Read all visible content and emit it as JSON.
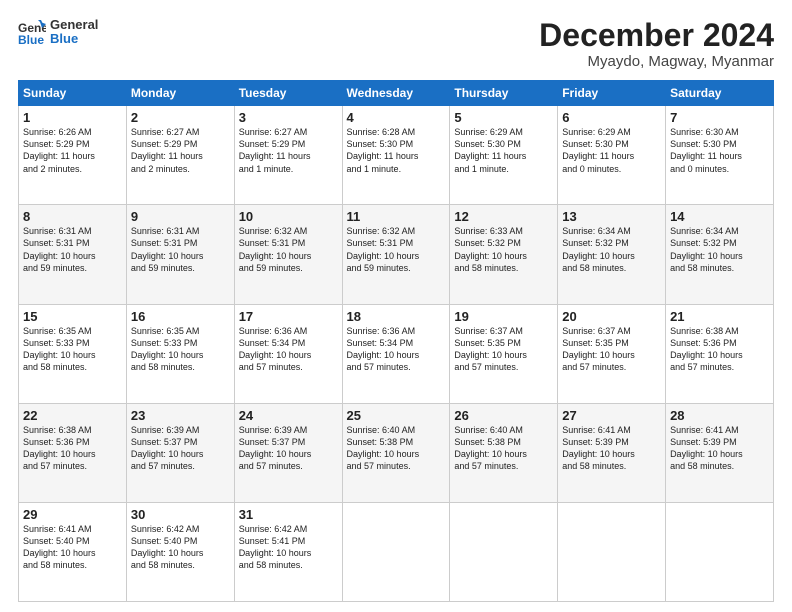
{
  "logo": {
    "line1": "General",
    "line2": "Blue"
  },
  "header": {
    "title": "December 2024",
    "subtitle": "Myaydo, Magway, Myanmar"
  },
  "columns": [
    "Sunday",
    "Monday",
    "Tuesday",
    "Wednesday",
    "Thursday",
    "Friday",
    "Saturday"
  ],
  "weeks": [
    [
      {
        "day": "1",
        "lines": [
          "Sunrise: 6:26 AM",
          "Sunset: 5:29 PM",
          "Daylight: 11 hours",
          "and 2 minutes."
        ]
      },
      {
        "day": "2",
        "lines": [
          "Sunrise: 6:27 AM",
          "Sunset: 5:29 PM",
          "Daylight: 11 hours",
          "and 2 minutes."
        ]
      },
      {
        "day": "3",
        "lines": [
          "Sunrise: 6:27 AM",
          "Sunset: 5:29 PM",
          "Daylight: 11 hours",
          "and 1 minute."
        ]
      },
      {
        "day": "4",
        "lines": [
          "Sunrise: 6:28 AM",
          "Sunset: 5:30 PM",
          "Daylight: 11 hours",
          "and 1 minute."
        ]
      },
      {
        "day": "5",
        "lines": [
          "Sunrise: 6:29 AM",
          "Sunset: 5:30 PM",
          "Daylight: 11 hours",
          "and 1 minute."
        ]
      },
      {
        "day": "6",
        "lines": [
          "Sunrise: 6:29 AM",
          "Sunset: 5:30 PM",
          "Daylight: 11 hours",
          "and 0 minutes."
        ]
      },
      {
        "day": "7",
        "lines": [
          "Sunrise: 6:30 AM",
          "Sunset: 5:30 PM",
          "Daylight: 11 hours",
          "and 0 minutes."
        ]
      }
    ],
    [
      {
        "day": "8",
        "lines": [
          "Sunrise: 6:31 AM",
          "Sunset: 5:31 PM",
          "Daylight: 10 hours",
          "and 59 minutes."
        ]
      },
      {
        "day": "9",
        "lines": [
          "Sunrise: 6:31 AM",
          "Sunset: 5:31 PM",
          "Daylight: 10 hours",
          "and 59 minutes."
        ]
      },
      {
        "day": "10",
        "lines": [
          "Sunrise: 6:32 AM",
          "Sunset: 5:31 PM",
          "Daylight: 10 hours",
          "and 59 minutes."
        ]
      },
      {
        "day": "11",
        "lines": [
          "Sunrise: 6:32 AM",
          "Sunset: 5:31 PM",
          "Daylight: 10 hours",
          "and 59 minutes."
        ]
      },
      {
        "day": "12",
        "lines": [
          "Sunrise: 6:33 AM",
          "Sunset: 5:32 PM",
          "Daylight: 10 hours",
          "and 58 minutes."
        ]
      },
      {
        "day": "13",
        "lines": [
          "Sunrise: 6:34 AM",
          "Sunset: 5:32 PM",
          "Daylight: 10 hours",
          "and 58 minutes."
        ]
      },
      {
        "day": "14",
        "lines": [
          "Sunrise: 6:34 AM",
          "Sunset: 5:32 PM",
          "Daylight: 10 hours",
          "and 58 minutes."
        ]
      }
    ],
    [
      {
        "day": "15",
        "lines": [
          "Sunrise: 6:35 AM",
          "Sunset: 5:33 PM",
          "Daylight: 10 hours",
          "and 58 minutes."
        ]
      },
      {
        "day": "16",
        "lines": [
          "Sunrise: 6:35 AM",
          "Sunset: 5:33 PM",
          "Daylight: 10 hours",
          "and 58 minutes."
        ]
      },
      {
        "day": "17",
        "lines": [
          "Sunrise: 6:36 AM",
          "Sunset: 5:34 PM",
          "Daylight: 10 hours",
          "and 57 minutes."
        ]
      },
      {
        "day": "18",
        "lines": [
          "Sunrise: 6:36 AM",
          "Sunset: 5:34 PM",
          "Daylight: 10 hours",
          "and 57 minutes."
        ]
      },
      {
        "day": "19",
        "lines": [
          "Sunrise: 6:37 AM",
          "Sunset: 5:35 PM",
          "Daylight: 10 hours",
          "and 57 minutes."
        ]
      },
      {
        "day": "20",
        "lines": [
          "Sunrise: 6:37 AM",
          "Sunset: 5:35 PM",
          "Daylight: 10 hours",
          "and 57 minutes."
        ]
      },
      {
        "day": "21",
        "lines": [
          "Sunrise: 6:38 AM",
          "Sunset: 5:36 PM",
          "Daylight: 10 hours",
          "and 57 minutes."
        ]
      }
    ],
    [
      {
        "day": "22",
        "lines": [
          "Sunrise: 6:38 AM",
          "Sunset: 5:36 PM",
          "Daylight: 10 hours",
          "and 57 minutes."
        ]
      },
      {
        "day": "23",
        "lines": [
          "Sunrise: 6:39 AM",
          "Sunset: 5:37 PM",
          "Daylight: 10 hours",
          "and 57 minutes."
        ]
      },
      {
        "day": "24",
        "lines": [
          "Sunrise: 6:39 AM",
          "Sunset: 5:37 PM",
          "Daylight: 10 hours",
          "and 57 minutes."
        ]
      },
      {
        "day": "25",
        "lines": [
          "Sunrise: 6:40 AM",
          "Sunset: 5:38 PM",
          "Daylight: 10 hours",
          "and 57 minutes."
        ]
      },
      {
        "day": "26",
        "lines": [
          "Sunrise: 6:40 AM",
          "Sunset: 5:38 PM",
          "Daylight: 10 hours",
          "and 57 minutes."
        ]
      },
      {
        "day": "27",
        "lines": [
          "Sunrise: 6:41 AM",
          "Sunset: 5:39 PM",
          "Daylight: 10 hours",
          "and 58 minutes."
        ]
      },
      {
        "day": "28",
        "lines": [
          "Sunrise: 6:41 AM",
          "Sunset: 5:39 PM",
          "Daylight: 10 hours",
          "and 58 minutes."
        ]
      }
    ],
    [
      {
        "day": "29",
        "lines": [
          "Sunrise: 6:41 AM",
          "Sunset: 5:40 PM",
          "Daylight: 10 hours",
          "and 58 minutes."
        ]
      },
      {
        "day": "30",
        "lines": [
          "Sunrise: 6:42 AM",
          "Sunset: 5:40 PM",
          "Daylight: 10 hours",
          "and 58 minutes."
        ]
      },
      {
        "day": "31",
        "lines": [
          "Sunrise: 6:42 AM",
          "Sunset: 5:41 PM",
          "Daylight: 10 hours",
          "and 58 minutes."
        ]
      },
      null,
      null,
      null,
      null
    ]
  ]
}
